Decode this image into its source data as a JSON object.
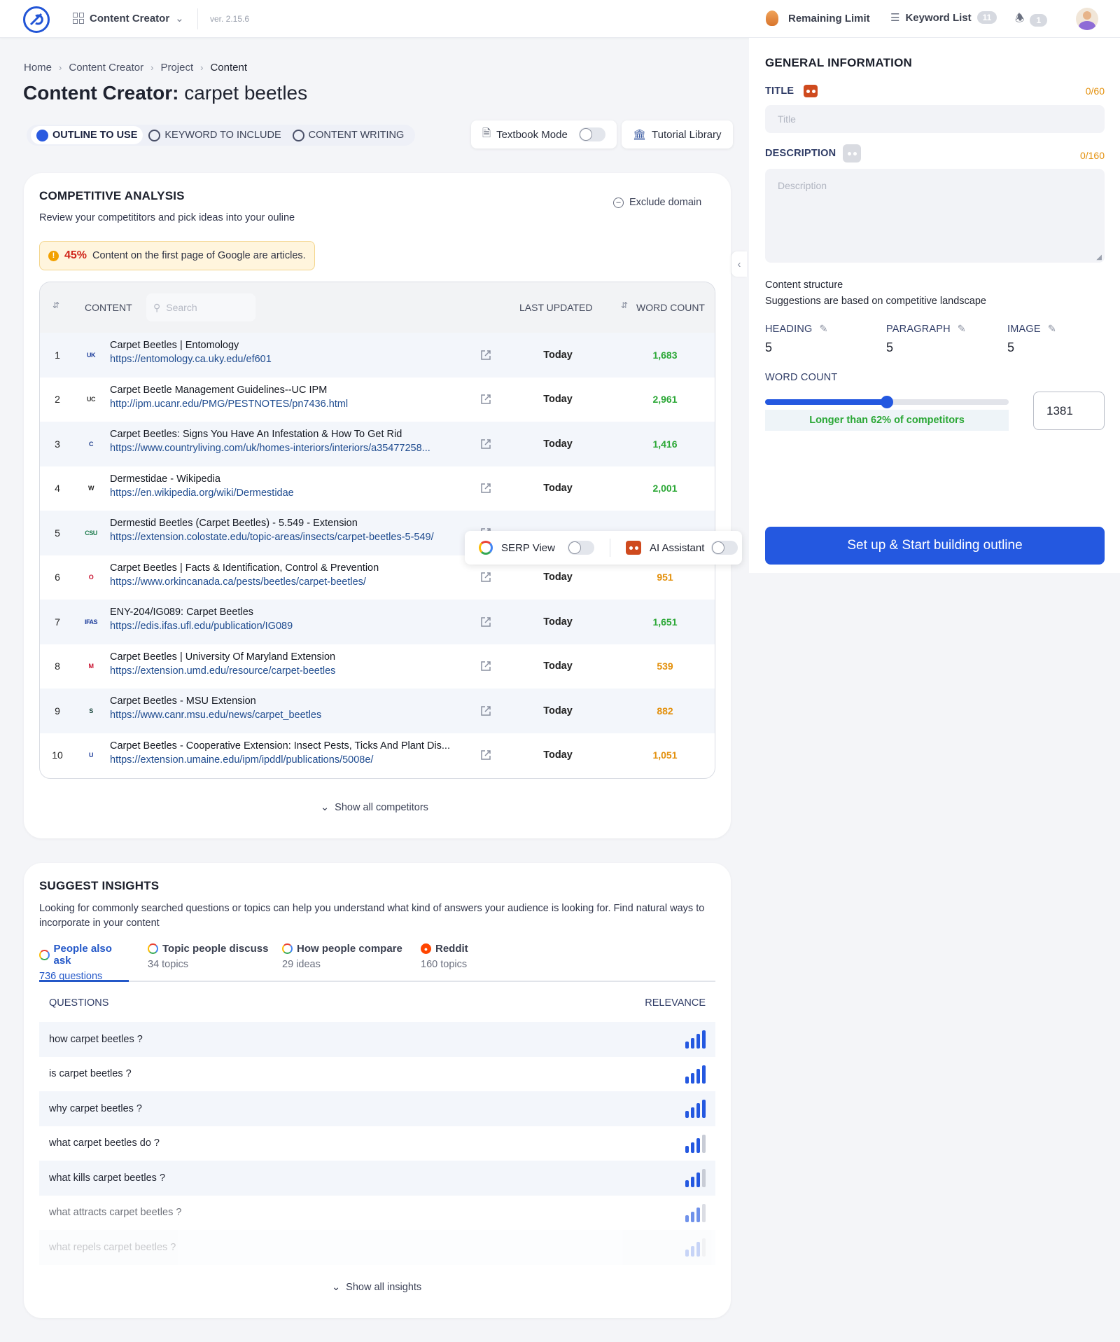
{
  "topbar": {
    "app_name": "Content Creator",
    "version": "ver. 2.15.6",
    "remaining_limit": "Remaining Limit",
    "keyword_list": "Keyword List",
    "keyword_count": "11",
    "notification_count": "1"
  },
  "breadcrumb": {
    "home": "Home",
    "content_creator": "Content Creator",
    "project": "Project",
    "content": "Content"
  },
  "page": {
    "title_bold": "Content Creator:",
    "title_rest": "carpet beetles"
  },
  "modes": {
    "outline": "OUTLINE TO USE",
    "keyword": "KEYWORD TO INCLUDE",
    "writing": "CONTENT WRITING"
  },
  "tools": {
    "textbook_mode": "Textbook Mode",
    "tutorial_library": "Tutorial Library"
  },
  "competitive": {
    "title": "COMPETITIVE ANALYSIS",
    "subtitle": "Review your competititors and pick ideas into your ouline",
    "exclude_domain": "Exclude domain",
    "alert_pct": "45%",
    "alert_text": "Content on the first page of Google are articles.",
    "col_content": "CONTENT",
    "search_placeholder": "Search",
    "col_last_updated": "LAST UPDATED",
    "col_word_count": "WORD COUNT",
    "show_all": "Show all competitors",
    "rows": [
      {
        "n": "1",
        "title": "Carpet Beetles | Entomology",
        "url": "https://entomology.ca.uky.edu/ef601",
        "date": "Today",
        "wc": "1,683",
        "wc_color": "green"
      },
      {
        "n": "2",
        "title": "Carpet Beetle Management Guidelines--UC IPM",
        "url": "http://ipm.ucanr.edu/PMG/PESTNOTES/pn7436.html",
        "date": "Today",
        "wc": "2,961",
        "wc_color": "green"
      },
      {
        "n": "3",
        "title": "Carpet Beetles: Signs You Have An Infestation & How To Get Rid",
        "url": "https://www.countryliving.com/uk/homes-interiors/interiors/a35477258...",
        "date": "Today",
        "wc": "1,416",
        "wc_color": "green"
      },
      {
        "n": "4",
        "title": "Dermestidae - Wikipedia",
        "url": "https://en.wikipedia.org/wiki/Dermestidae",
        "date": "Today",
        "wc": "2,001",
        "wc_color": "green"
      },
      {
        "n": "5",
        "title": "Dermestid Beetles (Carpet Beetles) - 5.549 - Extension",
        "url": "https://extension.colostate.edu/topic-areas/insects/carpet-beetles-5-549/",
        "date": "",
        "wc": "",
        "wc_color": "green"
      },
      {
        "n": "6",
        "title": "Carpet Beetles | Facts & Identification, Control & Prevention",
        "url": "https://www.orkincanada.ca/pests/beetles/carpet-beetles/",
        "date": "Today",
        "wc": "951",
        "wc_color": "orange"
      },
      {
        "n": "7",
        "title": "ENY-204/IG089: Carpet Beetles",
        "url": "https://edis.ifas.ufl.edu/publication/IG089",
        "date": "Today",
        "wc": "1,651",
        "wc_color": "green"
      },
      {
        "n": "8",
        "title": "Carpet Beetles | University Of Maryland Extension",
        "url": "https://extension.umd.edu/resource/carpet-beetles",
        "date": "Today",
        "wc": "539",
        "wc_color": "orange"
      },
      {
        "n": "9",
        "title": "Carpet Beetles - MSU Extension",
        "url": "https://www.canr.msu.edu/news/carpet_beetles",
        "date": "Today",
        "wc": "882",
        "wc_color": "orange"
      },
      {
        "n": "10",
        "title": "Carpet Beetles - Cooperative Extension: Insect Pests, Ticks And Plant Dis...",
        "url": "https://extension.umaine.edu/ipm/ipddl/publications/5008e/",
        "date": "Today",
        "wc": "1,051",
        "wc_color": "orange"
      }
    ],
    "favicons": [
      "UK",
      "UC",
      "C",
      "W",
      "CSU",
      "O",
      "IFAS",
      "M",
      "S",
      "U"
    ]
  },
  "floatbar": {
    "serp_view": "SERP View",
    "ai_assistant": "AI Assistant"
  },
  "general": {
    "title": "GENERAL INFORMATION",
    "title_label": "TITLE",
    "title_count": "0/60",
    "title_placeholder": "Title",
    "desc_label": "DESCRIPTION",
    "desc_count": "0/160",
    "desc_placeholder": "Description",
    "structure_title": "Content structure",
    "structure_sub": "Suggestions are based on competitive landscape",
    "heading_label": "HEADING",
    "heading_val": "5",
    "paragraph_label": "PARAGRAPH",
    "paragraph_val": "5",
    "image_label": "IMAGE",
    "image_val": "5",
    "word_count_label": "WORD COUNT",
    "word_count_value": "1381",
    "word_count_slider": 0.5,
    "longer_than": "Longer than 62% of competitors",
    "cta": "Set up & Start building outline"
  },
  "insights": {
    "title": "SUGGEST INSIGHTS",
    "subtitle": "Looking for commonly searched questions or topics can help you understand what kind of answers your audience is looking for. Find natural ways to incorporate in your content",
    "tabs": [
      {
        "label": "People also ask",
        "count": "736 questions"
      },
      {
        "label": "Topic people discuss",
        "count": "34 topics"
      },
      {
        "label": "How people compare",
        "count": "29 ideas"
      },
      {
        "label": "Reddit",
        "count": "160 topics"
      }
    ],
    "col_questions": "QUESTIONS",
    "col_relevance": "RELEVANCE",
    "questions": [
      {
        "q": "how carpet beetles ?",
        "rel": 4
      },
      {
        "q": "is carpet beetles ?",
        "rel": 4
      },
      {
        "q": "why carpet beetles ?",
        "rel": 4
      },
      {
        "q": "what carpet beetles do ?",
        "rel": 3
      },
      {
        "q": "what kills carpet beetles ?",
        "rel": 3
      },
      {
        "q": "what attracts carpet beetles ?",
        "rel": 3
      },
      {
        "q": "what repels carpet beetles ?",
        "rel": 3
      }
    ],
    "show_all": "Show all insights"
  },
  "colors": {
    "accent": "#2458e0",
    "green": "#2aa735",
    "orange": "#e3900c",
    "warning_bg": "#fff5dd"
  }
}
